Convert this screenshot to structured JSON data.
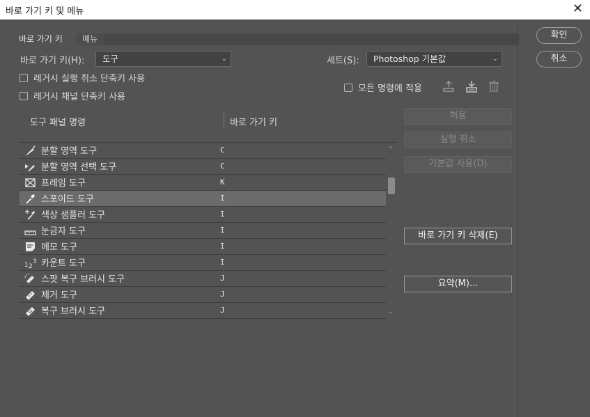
{
  "window": {
    "title": "바로 가기 키 및 메뉴",
    "close_glyph": "✕"
  },
  "dialog_buttons": {
    "ok": "확인",
    "cancel": "취소"
  },
  "tabs": [
    {
      "label": "바로 가기 키",
      "active": true
    },
    {
      "label": "메뉴",
      "active": false
    }
  ],
  "shortcuts_for": {
    "label": "바로 가기 키(H):",
    "value": "도구"
  },
  "set": {
    "label": "세트(S):",
    "value": "Photoshop 기본값"
  },
  "checkboxes": {
    "legacy_undo": {
      "label": "레거시 실행 취소 단축키 사용",
      "checked": false
    },
    "legacy_channel": {
      "label": "레거시 채널 단축키 사용",
      "checked": false
    },
    "apply_all": {
      "label": "모든 명령에 적용",
      "checked": false
    }
  },
  "icons": {
    "save_set": "save-set-icon",
    "new_set": "new-set-icon",
    "delete_set": "trash-icon"
  },
  "columns": {
    "command": "도구 패널 명령",
    "shortcut": "바로 가기 키"
  },
  "rows": [
    {
      "name": "분할 영역 도구",
      "key": "C",
      "icon": "slice-tool-icon",
      "selected": false
    },
    {
      "name": "분할 영역 선택 도구",
      "key": "C",
      "icon": "slice-select-tool-icon",
      "selected": false
    },
    {
      "name": "프레임 도구",
      "key": "K",
      "icon": "frame-tool-icon",
      "selected": false
    },
    {
      "name": "스포이드 도구",
      "key": "I",
      "icon": "eyedropper-tool-icon",
      "selected": true
    },
    {
      "name": "색상 샘플러 도구",
      "key": "I",
      "icon": "color-sampler-tool-icon",
      "selected": false
    },
    {
      "name": "눈금자 도구",
      "key": "I",
      "icon": "ruler-tool-icon",
      "selected": false
    },
    {
      "name": "메모 도구",
      "key": "I",
      "icon": "note-tool-icon",
      "selected": false
    },
    {
      "name": "카운트 도구",
      "key": "I",
      "icon": "count-tool-icon",
      "selected": false
    },
    {
      "name": "스팟 복구 브러시 도구",
      "key": "J",
      "icon": "spot-healing-brush-icon",
      "selected": false
    },
    {
      "name": "제거 도구",
      "key": "J",
      "icon": "remove-tool-icon",
      "selected": false
    },
    {
      "name": "복구 브러시 도구",
      "key": "J",
      "icon": "healing-brush-icon",
      "selected": false
    }
  ],
  "count_glyph": {
    "a": "1",
    "b": "2",
    "c": "3"
  },
  "side_buttons": {
    "accept": "허용",
    "undo": "실행 취소",
    "use_default": "기본값 사용(D)",
    "delete_shortcut": "바로 가기 키 삭제(E)",
    "summarize": "요약(M)..."
  },
  "colors": {
    "background": "#535353",
    "titlebar": "#ffffff",
    "selected_row": "#6b6b6b"
  }
}
